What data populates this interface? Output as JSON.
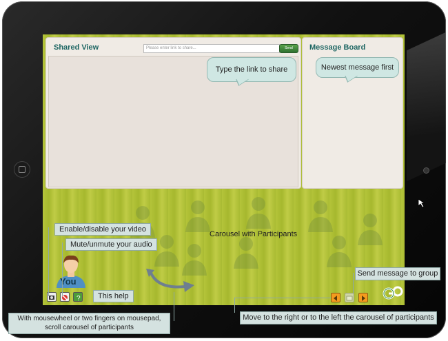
{
  "shared_view": {
    "title": "Shared View",
    "link_placeholder": "Please enter link to share...",
    "send_label": "Send"
  },
  "message_board": {
    "title": "Message Board"
  },
  "callouts": {
    "share": "Type the link to share",
    "newest": "Newest message first",
    "carousel": "Carousel with Participants",
    "video": "Enable/disable your video",
    "audio": "Mute/unmute your audio",
    "help": "This help",
    "send_group": "Send message to group",
    "move_carousel": "Move to the right or to the left the carousel of participants",
    "scroll_carousel": "With mousewheel or two fingers on mousepad, scroll carousel of participants"
  },
  "self_label": "You",
  "colors": {
    "accent_teal": "#1e6663",
    "screen_green": "#b4c43a",
    "nav_orange": "#f59b1e"
  },
  "icons": [
    "camera-icon",
    "mute-icon",
    "help-icon",
    "arrow-left-icon",
    "message-icon",
    "arrow-right-icon",
    "go-logo-icon"
  ]
}
